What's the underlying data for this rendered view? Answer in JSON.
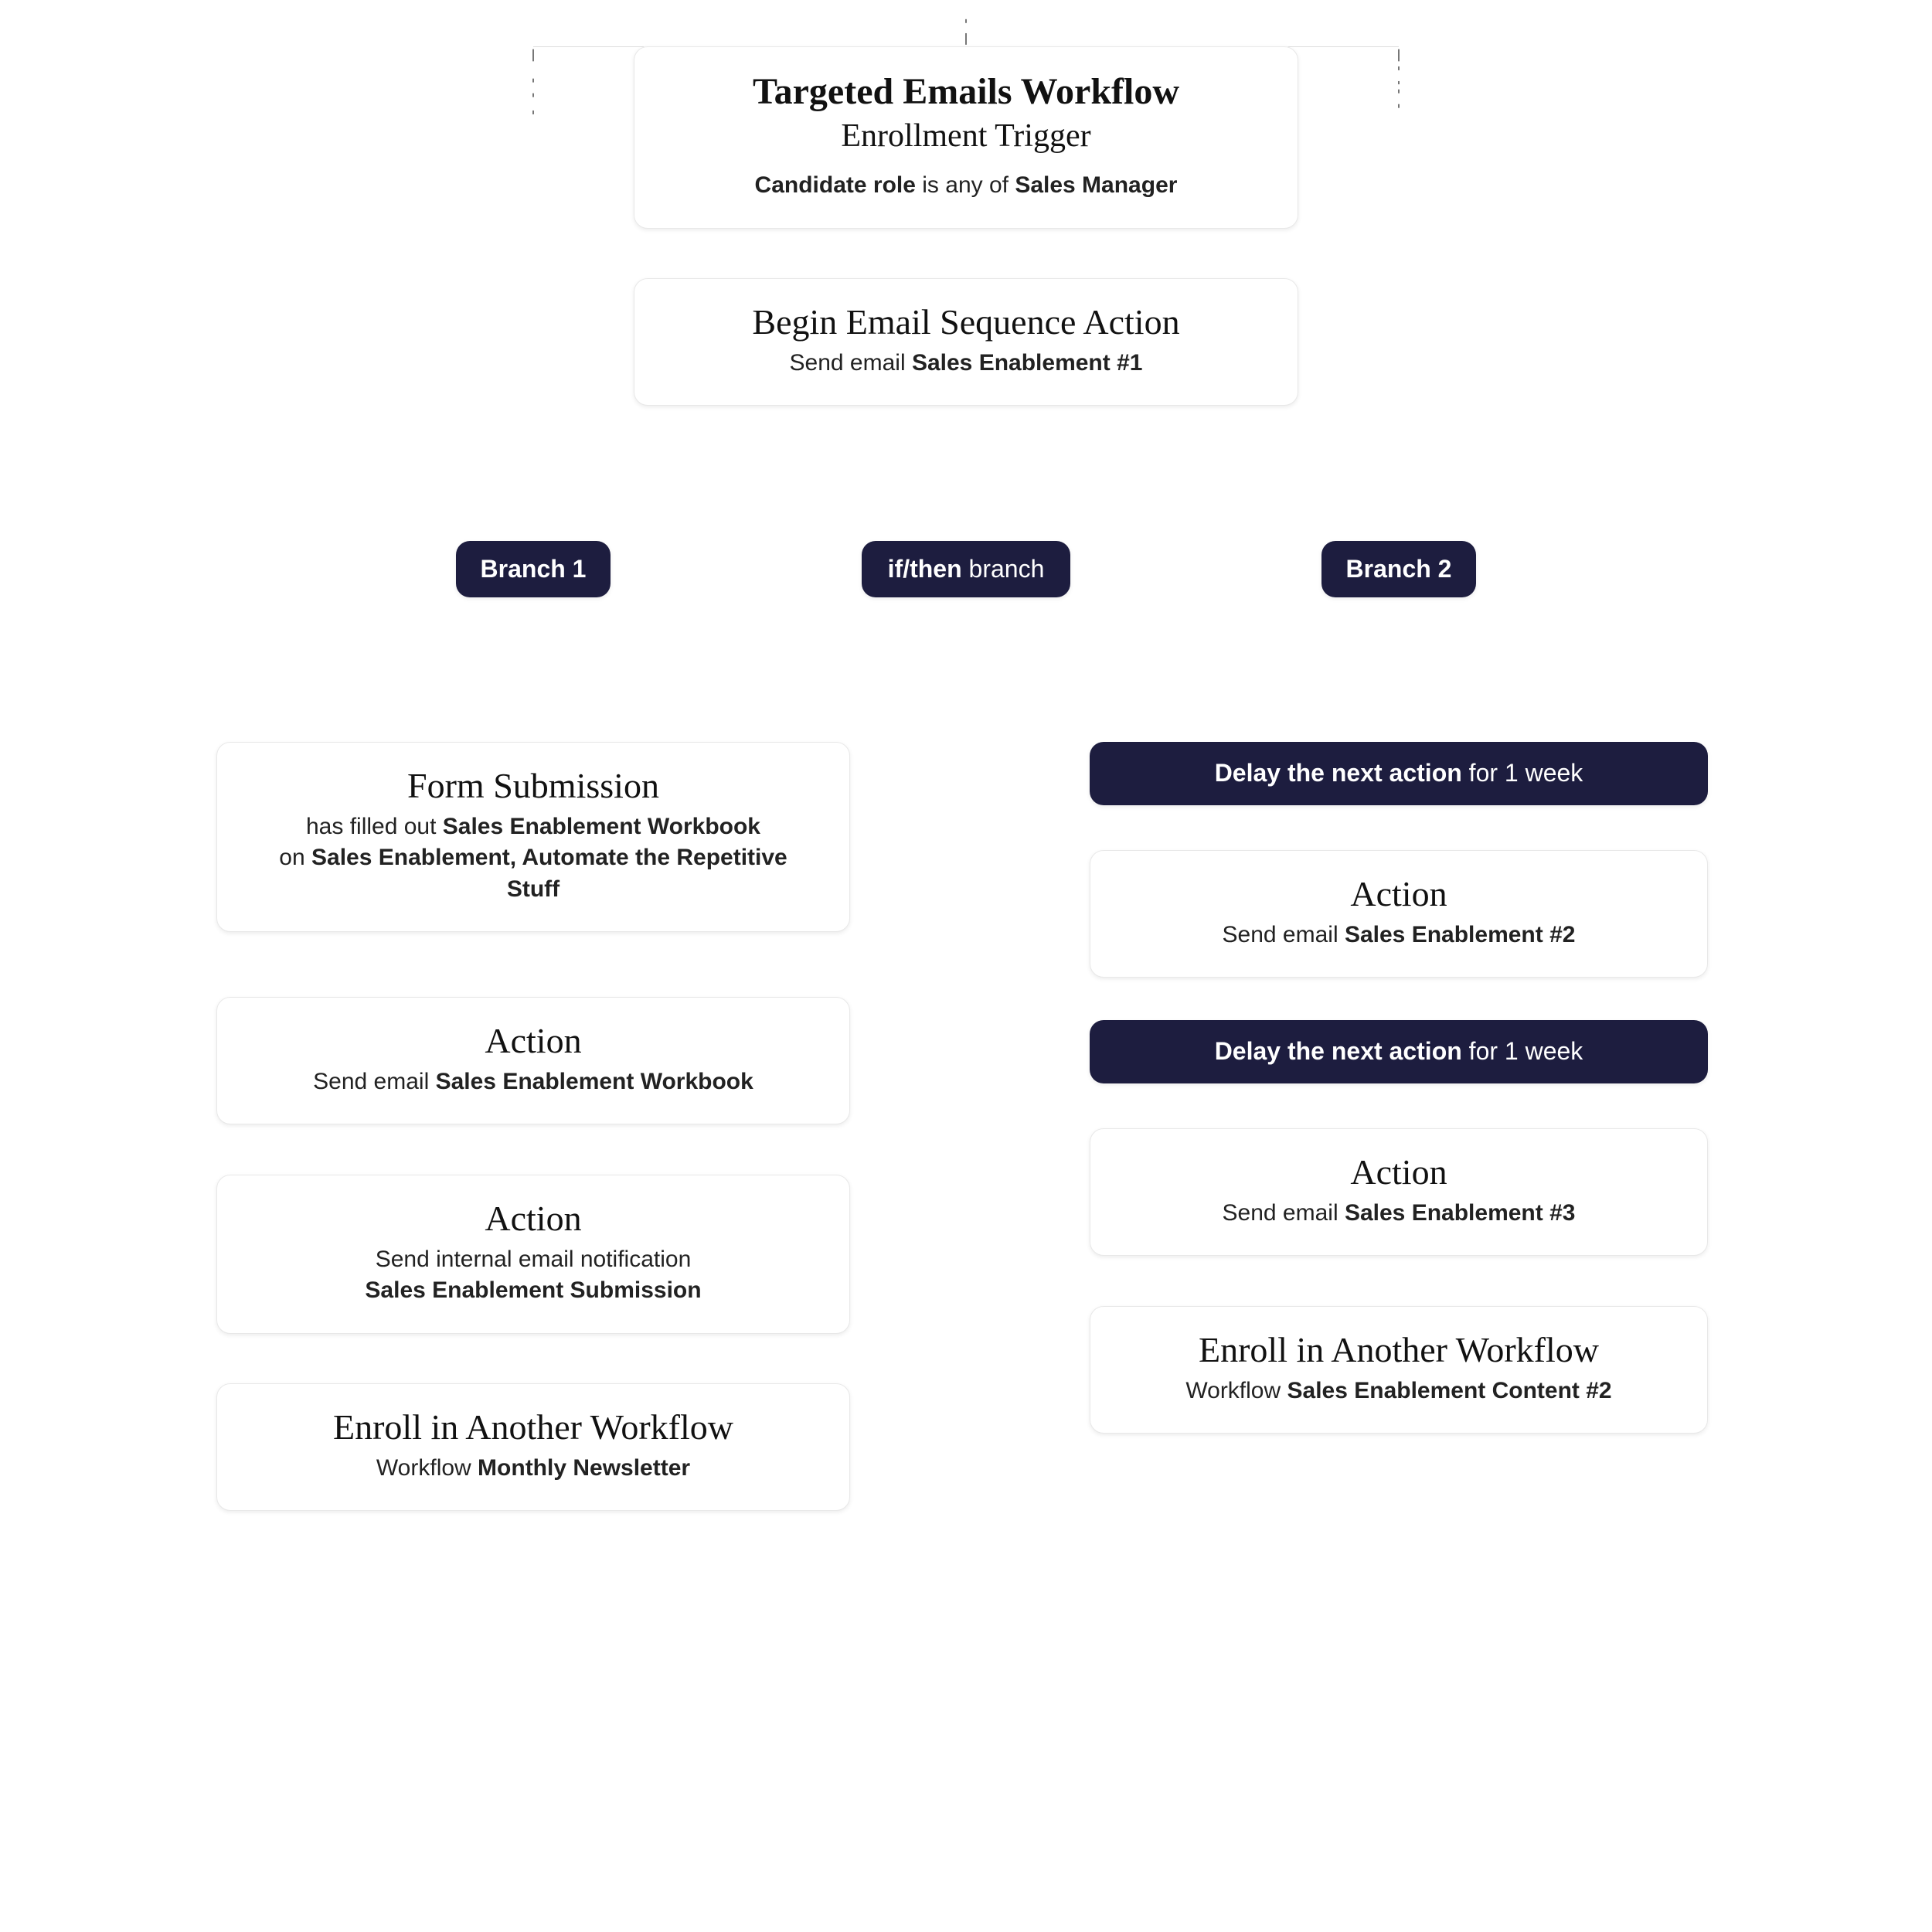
{
  "colors": {
    "dark_pill": "#1d1d3f"
  },
  "trigger": {
    "title": "Targeted Emails Workflow",
    "subtitle": "Enrollment Trigger",
    "detail_prefix": "Candidate role",
    "detail_middle": " is any of ",
    "detail_value": "Sales Manager"
  },
  "begin_action": {
    "title": "Begin Email Sequence Action",
    "detail_prefix": "Send email ",
    "detail_value": "Sales Enablement #1"
  },
  "branch_hub": {
    "ifthen_bold": "if/then",
    "ifthen_rest": " branch",
    "branch1": "Branch 1",
    "branch2": "Branch 2"
  },
  "branch1": {
    "form": {
      "title": "Form Submission",
      "line1_prefix": "has filled out ",
      "line1_bold": "Sales Enablement Workbook",
      "line2_prefix": "on ",
      "line2_bold": "Sales Enablement, Automate the Repetitive Stuff"
    },
    "action1": {
      "title": "Action",
      "detail_prefix": "Send email ",
      "detail_value": "Sales Enablement Workbook"
    },
    "action2": {
      "title": "Action",
      "detail_prefix": "Send internal email notification",
      "detail_value": "Sales Enablement Submission"
    },
    "enroll": {
      "title": "Enroll in Another Workflow",
      "detail_prefix": "Workflow ",
      "detail_value": "Monthly Newsletter"
    }
  },
  "branch2": {
    "delay1": {
      "bold": "Delay the next action",
      "rest": " for 1 week"
    },
    "action1": {
      "title": "Action",
      "detail_prefix": "Send email ",
      "detail_value": "Sales Enablement #2"
    },
    "delay2": {
      "bold": "Delay the next action",
      "rest": " for 1 week"
    },
    "action2": {
      "title": "Action",
      "detail_prefix": "Send email ",
      "detail_value": "Sales Enablement #3"
    },
    "enroll": {
      "title": "Enroll in Another Workflow",
      "detail_prefix": "Workflow ",
      "detail_value": "Sales Enablement Content #2"
    }
  }
}
